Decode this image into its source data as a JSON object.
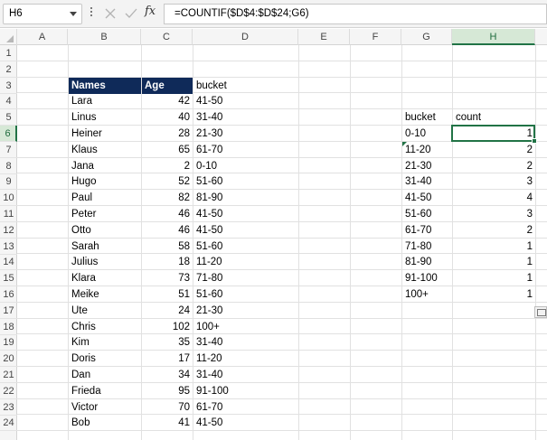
{
  "formula_bar": {
    "name_box": "H6",
    "fx_label": "fx",
    "formula": "=COUNTIF($D$4:$D$24;G6)"
  },
  "columns": [
    "A",
    "B",
    "C",
    "D",
    "E",
    "F",
    "G",
    "H"
  ],
  "rows": [
    "1",
    "2",
    "3",
    "4",
    "5",
    "6",
    "7",
    "8",
    "9",
    "10",
    "11",
    "12",
    "13",
    "14",
    "15",
    "16",
    "17",
    "18",
    "19",
    "20",
    "21",
    "22",
    "23",
    "24"
  ],
  "active_cell": {
    "column": "H",
    "row": "6"
  },
  "main_table": {
    "headers": {
      "names": "Names",
      "age": "Age",
      "bucket": "bucket"
    },
    "rows": [
      {
        "name": "Lara",
        "age": "42",
        "bucket": "41-50"
      },
      {
        "name": "Linus",
        "age": "40",
        "bucket": "31-40"
      },
      {
        "name": "Heiner",
        "age": "28",
        "bucket": "21-30"
      },
      {
        "name": "Klaus",
        "age": "65",
        "bucket": "61-70"
      },
      {
        "name": "Jana",
        "age": "2",
        "bucket": "0-10"
      },
      {
        "name": "Hugo",
        "age": "52",
        "bucket": "51-60"
      },
      {
        "name": "Paul",
        "age": "82",
        "bucket": "81-90"
      },
      {
        "name": "Peter",
        "age": "46",
        "bucket": "41-50"
      },
      {
        "name": "Otto",
        "age": "46",
        "bucket": "41-50"
      },
      {
        "name": "Sarah",
        "age": "58",
        "bucket": "51-60"
      },
      {
        "name": "Julius",
        "age": "18",
        "bucket": "11-20"
      },
      {
        "name": "Klara",
        "age": "73",
        "bucket": "71-80"
      },
      {
        "name": "Meike",
        "age": "51",
        "bucket": "51-60"
      },
      {
        "name": "Ute",
        "age": "24",
        "bucket": "21-30"
      },
      {
        "name": "Chris",
        "age": "102",
        "bucket": "100+"
      },
      {
        "name": "Kim",
        "age": "35",
        "bucket": "31-40"
      },
      {
        "name": "Doris",
        "age": "17",
        "bucket": "11-20"
      },
      {
        "name": "Dan",
        "age": "34",
        "bucket": "31-40"
      },
      {
        "name": "Frieda",
        "age": "95",
        "bucket": "91-100"
      },
      {
        "name": "Victor",
        "age": "70",
        "bucket": "61-70"
      },
      {
        "name": "Bob",
        "age": "41",
        "bucket": "41-50"
      }
    ]
  },
  "count_table": {
    "headers": {
      "bucket": "bucket",
      "count": "count"
    },
    "rows": [
      {
        "bucket": "0-10",
        "count": "1"
      },
      {
        "bucket": "11-20",
        "count": "2"
      },
      {
        "bucket": "21-30",
        "count": "2"
      },
      {
        "bucket": "31-40",
        "count": "3"
      },
      {
        "bucket": "41-50",
        "count": "4"
      },
      {
        "bucket": "51-60",
        "count": "3"
      },
      {
        "bucket": "61-70",
        "count": "2"
      },
      {
        "bucket": "71-80",
        "count": "1"
      },
      {
        "bucket": "81-90",
        "count": "1"
      },
      {
        "bucket": "91-100",
        "count": "1"
      },
      {
        "bucket": "100+",
        "count": "1"
      }
    ]
  },
  "colors": {
    "header_fill": "#0f2a59",
    "selection": "#217346"
  }
}
